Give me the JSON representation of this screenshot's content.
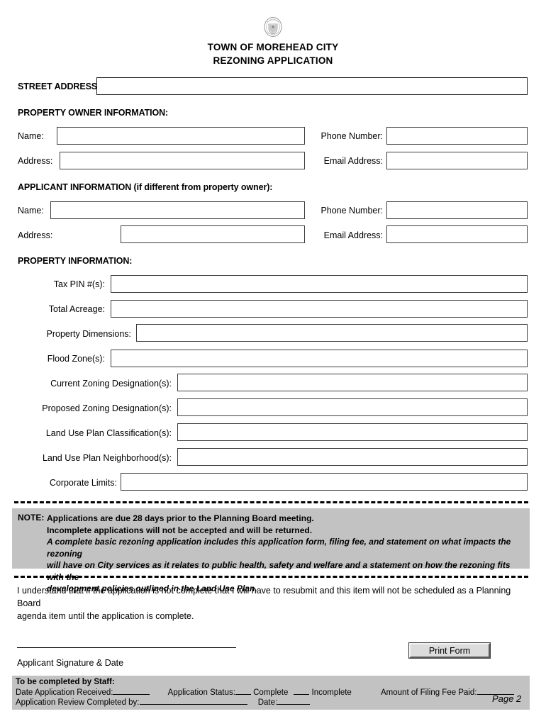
{
  "header": {
    "seal_icon": "town-seal-icon",
    "title_line1": "TOWN OF MOREHEAD CITY",
    "title_line2": "REZONING APPLICATION"
  },
  "street": {
    "label": "STREET ADDRESS:",
    "value": "",
    "placeholder": ""
  },
  "owner_section": {
    "heading": "PROPERTY OWNER INFORMATION:",
    "fields": [
      {
        "label": "Name:",
        "value": ""
      },
      {
        "label": "Address:",
        "value": ""
      },
      {
        "label": "Phone Number:",
        "value": ""
      },
      {
        "label": "Email Address:",
        "value": ""
      }
    ]
  },
  "applicant_section": {
    "heading": "APPLICANT INFORMATION (if different from property owner):",
    "fields": [
      {
        "label": "Name:",
        "value": ""
      },
      {
        "label": "Address:",
        "value": ""
      },
      {
        "label": "Phone Number:",
        "value": ""
      },
      {
        "label": "Email Address:",
        "value": ""
      }
    ]
  },
  "property_section": {
    "heading": "PROPERTY INFORMATION:",
    "fields": [
      {
        "label": "Tax PIN #(s):",
        "value": ""
      },
      {
        "label": "Total Acreage:",
        "value": ""
      },
      {
        "label": "Property Dimensions:",
        "value": ""
      },
      {
        "label": "Flood Zone(s):",
        "value": ""
      },
      {
        "label": "Current Zoning Designation(s):",
        "value": ""
      },
      {
        "label": "Proposed Zoning Designation(s):",
        "value": ""
      },
      {
        "label": "Land Use Plan Classification(s):",
        "value": ""
      },
      {
        "label": "Land Use Plan Neighborhood(s):",
        "value": ""
      },
      {
        "label": "Corporate Limits:",
        "value": ""
      }
    ]
  },
  "note": {
    "label": "NOTE:",
    "line1": "Applications are due 28 days prior to the Planning Board meeting.",
    "line2": "Incomplete applications will not be accepted and will be returned.",
    "line3": "A complete basic rezoning application includes this application form, filing fee, and statement on what impacts the rezoning",
    "line4": "will have on City services as it relates to public health, safety and welfare and a statement on how the rezoning fits with the",
    "line5": "development policies outlined in the Land Use Plan.",
    "background_color": "#c2c2c2"
  },
  "statement": {
    "line1": "I understand that if the application is not complete that I will have to resubmit and this item will not be scheduled as a Planning Board",
    "line2": "agenda item until the application is complete."
  },
  "signature": {
    "caption": "Applicant Signature & Date",
    "value": ""
  },
  "print_button": {
    "label": "Print Form"
  },
  "staff": {
    "title": "To be completed by Staff:",
    "date_received_label": "Date Application Received:",
    "status_label": "Application Status:",
    "status_complete": "Complete",
    "status_incomplete": "Incomplete",
    "fee_label": "Amount of Filing Fee Paid:",
    "review_by_label": "Application Review Completed by:",
    "review_date_label": "Date:",
    "page_number": "Page 2",
    "background_color": "#c2c2c2"
  }
}
